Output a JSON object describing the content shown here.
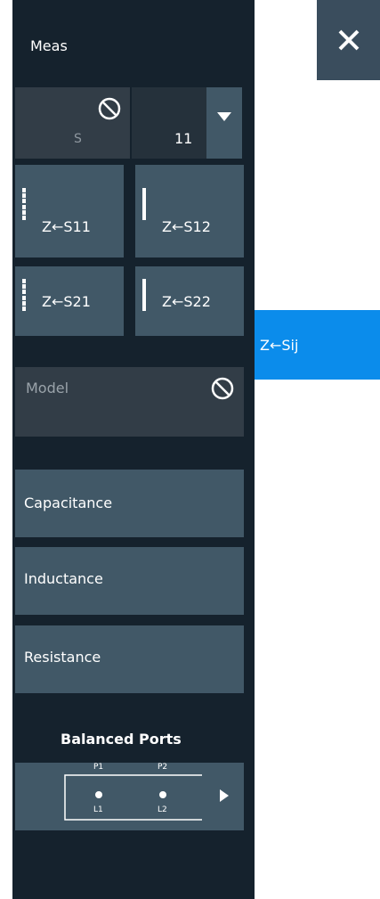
{
  "header": {
    "title": "Meas"
  },
  "s_param": {
    "letter": "S",
    "value": "11"
  },
  "buttons": {
    "z_s11": "Z←S11",
    "z_s12": "Z←S12",
    "z_s21": "Z←S21",
    "z_s22": "Z←S22"
  },
  "selected": {
    "label": "Z←Sij"
  },
  "model": {
    "label": "Model"
  },
  "list": {
    "capacitance": "Capacitance",
    "inductance": "Inductance",
    "resistance": "Resistance"
  },
  "balanced": {
    "title": "Balanced Ports",
    "p1": "P1",
    "p2": "P2",
    "l1": "L1",
    "l2": "L2"
  }
}
